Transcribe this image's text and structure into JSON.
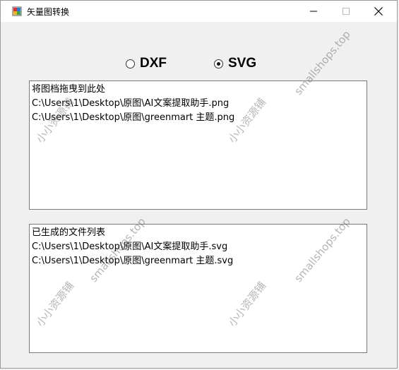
{
  "window": {
    "title": "矢量图转换",
    "app_icon": "app-icon",
    "controls": {
      "minimize_icon": "minimize-icon",
      "maximize_icon": "maximize-icon",
      "close_icon": "close-icon"
    }
  },
  "format_options": [
    {
      "label": "DXF",
      "checked": false
    },
    {
      "label": "SVG",
      "checked": true
    }
  ],
  "input_list": {
    "header": "将图档拖曳到此处",
    "items": [
      "C:\\Users\\1\\Desktop\\原图\\AI文案提取助手.png",
      "C:\\Users\\1\\Desktop\\原图\\greenmart 主题.png"
    ]
  },
  "output_list": {
    "header": "已生成的文件列表",
    "items": [
      "C:\\Users\\1\\Desktop\\原图\\AI文案提取助手.svg",
      "C:\\Users\\1\\Desktop\\原图\\greenmart 主题.svg"
    ]
  },
  "watermarks": {
    "brand_cn": "小小资源铺",
    "brand_url": "smallshops.top"
  }
}
